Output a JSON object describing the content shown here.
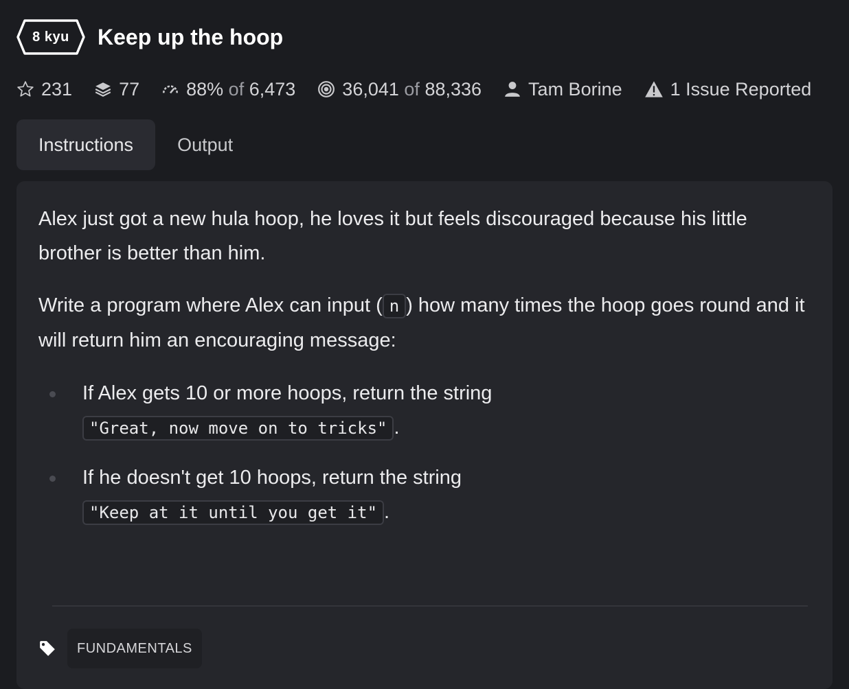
{
  "kata": {
    "rank": "8 kyu",
    "title": "Keep up the hoop"
  },
  "stats": {
    "stars": "231",
    "collections": "77",
    "satisfaction_pct": "88%",
    "satisfaction_of": "of",
    "satisfaction_votes": "6,473",
    "completed": "36,041",
    "completed_of": "of",
    "attempts": "88,336",
    "author": "Tam Borine",
    "issues": "1 Issue Reported"
  },
  "tabs": [
    {
      "label": "Instructions",
      "active": true
    },
    {
      "label": "Output",
      "active": false
    }
  ],
  "description": {
    "p1": "Alex just got a new hula hoop, he loves it but feels discouraged because his little brother is better than him.",
    "p2_before": "Write a program where Alex can input (",
    "p2_code": "n",
    "p2_after": ") how many times the hoop goes round and it will return him an encouraging message:",
    "bullets": [
      {
        "text": "If Alex gets 10 or more hoops, return the string",
        "code": "\"Great, now move on to tricks\"",
        "end": "."
      },
      {
        "text": "If he doesn't get 10 hoops, return the string",
        "code": "\"Keep at it until you get it\"",
        "end": "."
      }
    ]
  },
  "tags": [
    "FUNDAMENTALS"
  ]
}
